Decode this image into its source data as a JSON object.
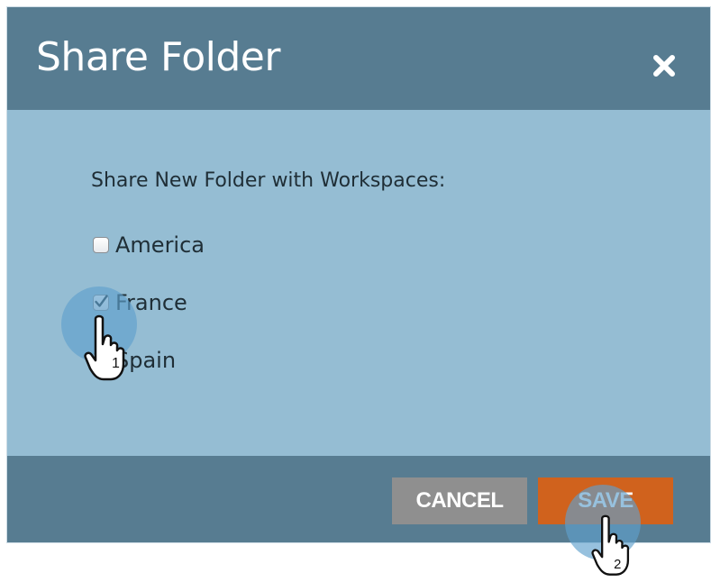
{
  "dialog": {
    "title": "Share Folder",
    "close_icon": "close-icon"
  },
  "body": {
    "prompt": "Share New Folder with Workspaces:",
    "workspaces": [
      {
        "label": "America",
        "checked": false
      },
      {
        "label": "France",
        "checked": true
      },
      {
        "label": "Spain",
        "checked": false
      }
    ]
  },
  "footer": {
    "cancel_label": "CANCEL",
    "save_label": "SAVE"
  },
  "annotations": [
    {
      "step": "1",
      "icon": "pointer-hand-icon"
    },
    {
      "step": "2",
      "icon": "pointer-hand-icon"
    }
  ],
  "colors": {
    "header": "#577c91",
    "body": "#95bdd3",
    "cancel": "#8f8f8f",
    "save": "#d0621d",
    "halo": "#5fa0cd"
  }
}
